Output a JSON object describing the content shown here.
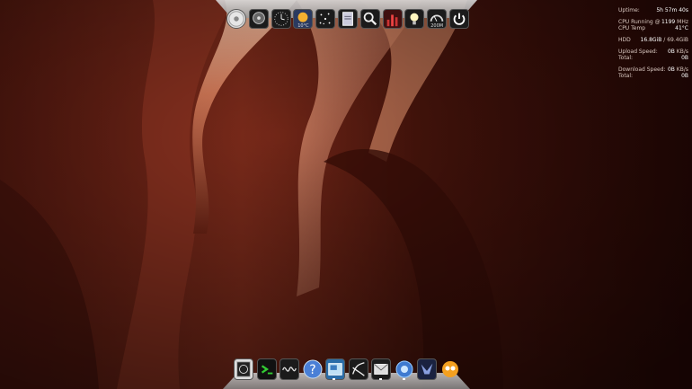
{
  "desktop": {
    "wallpaper": "antelope-canyon"
  },
  "top_dock": {
    "icons": [
      {
        "name": "cd-icon"
      },
      {
        "name": "hard-drive-icon"
      },
      {
        "name": "clock-icon"
      },
      {
        "name": "weather-icon",
        "label": "10°C"
      },
      {
        "name": "starfield-icon"
      },
      {
        "name": "document-icon"
      },
      {
        "name": "magnifier-icon"
      },
      {
        "name": "cpu-meter-icon"
      },
      {
        "name": "lightbulb-icon"
      },
      {
        "name": "ram-gauge-icon",
        "label": "200M"
      },
      {
        "name": "power-icon"
      }
    ]
  },
  "conky": {
    "uptime_label": "Uptime:",
    "uptime_value": "5h 57m 40s",
    "cpu_running_label": "CPU Running @",
    "cpu_running_value": "1199",
    "cpu_running_unit": "MHz",
    "cpu_temp_label": "CPU Temp",
    "cpu_temp_value": "41°C",
    "hdd_label": "HDD",
    "hdd_used": "16.8GiB",
    "hdd_sep": "/",
    "hdd_total": "69.4GiB",
    "upload_label": "Upload Speed:",
    "upload_value": "0B",
    "upload_unit": "KB/s",
    "upload_total_label": "Total:",
    "upload_total_value": "0B",
    "download_label": "Download Speed:",
    "download_value": "0B",
    "download_unit": "KB/s",
    "download_total_label": "Total:",
    "download_total_value": "0B"
  },
  "bottom_dock": {
    "icons": [
      {
        "name": "system-monitor-icon"
      },
      {
        "name": "terminal-icon"
      },
      {
        "name": "waveform-icon"
      },
      {
        "name": "help-icon"
      },
      {
        "name": "image-viewer-icon"
      },
      {
        "name": "audio-editor-icon"
      },
      {
        "name": "mail-icon"
      },
      {
        "name": "browser-icon"
      },
      {
        "name": "bird-icon"
      },
      {
        "name": "media-icon"
      }
    ]
  }
}
